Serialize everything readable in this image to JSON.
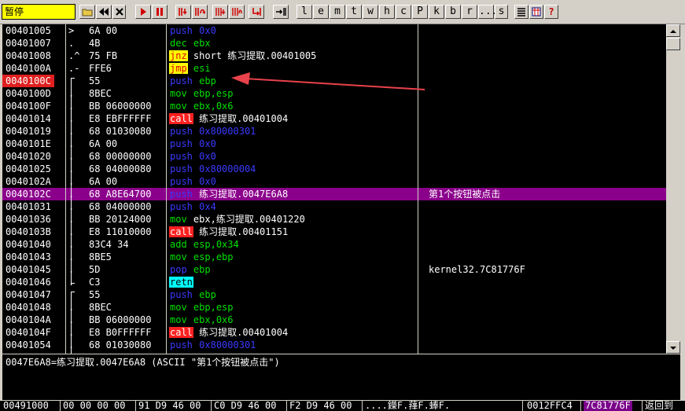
{
  "toolbar": {
    "status": "暂停",
    "letters": [
      "l",
      "e",
      "m",
      "t",
      "w",
      "h",
      "c",
      "P",
      "k",
      "b",
      "r",
      "...",
      "s"
    ]
  },
  "icons": [
    "open-icon",
    "rewind-icon",
    "close-icon",
    "run-icon",
    "pause-icon",
    "step-into-icon",
    "step-over-icon",
    "trace-into-icon",
    "trace-over-icon",
    "execute-till-return-icon",
    "goto-icon",
    "list-icon",
    "grid-icon",
    "help-icon"
  ],
  "colors": {
    "status_bg": "#ffff00",
    "selected_row": "#8b008b",
    "breakpoint": "#e02020",
    "push": "#3a3aff",
    "mov": "#00e000",
    "call_bg": "#ff2020",
    "jmp_bg": "#ffff00",
    "retn_bg": "#00ffff",
    "arrow": "#e8424a"
  },
  "rows": [
    {
      "addr": "00401005",
      "mark": ">",
      "hex": "6A 00",
      "kw": "push",
      "kc": "k-push",
      "op": "0x0",
      "oc": "op-blue",
      "cmt": ""
    },
    {
      "addr": "00401007",
      "mark": ".",
      "hex": "4B",
      "kw": "dec",
      "kc": "k-dec",
      "op": "ebx",
      "oc": "op-green",
      "cmt": ""
    },
    {
      "addr": "00401008",
      "mark": ".^",
      "hex": "75 FB",
      "kw": "jnz",
      "kc": "k-jnz",
      "op": "short 练习提取.00401005",
      "oc": "op-white",
      "cmt": ""
    },
    {
      "addr": "0040100A",
      "mark": ".-",
      "hex": "FFE6",
      "kw": "jmp",
      "kc": "k-jmp",
      "op": "esi",
      "oc": "op-green",
      "cmt": ""
    },
    {
      "addr": "0040100C",
      "mark": "",
      "hex": "55",
      "kw": "push",
      "kc": "k-push",
      "op": "ebp",
      "oc": "op-green",
      "cmt": "",
      "bp": true
    },
    {
      "addr": "0040100D",
      "mark": ".",
      "hex": "8BEC",
      "kw": "mov",
      "kc": "k-mov",
      "op": "ebp,esp",
      "oc": "op-green",
      "cmt": ""
    },
    {
      "addr": "0040100F",
      "mark": ".",
      "hex": "BB 06000000",
      "kw": "mov",
      "kc": "k-mov",
      "op": "ebx,0x6",
      "oc": "op-green",
      "cmt": ""
    },
    {
      "addr": "00401014",
      "mark": ".",
      "hex": "E8 EBFFFFFF",
      "kw": "call",
      "kc": "k-call",
      "op": "练习提取.00401004",
      "oc": "op-white",
      "cmt": ""
    },
    {
      "addr": "00401019",
      "mark": ".",
      "hex": "68 01030080",
      "kw": "push",
      "kc": "k-push",
      "op": "0x80000301",
      "oc": "op-blue",
      "cmt": ""
    },
    {
      "addr": "0040101E",
      "mark": ".",
      "hex": "6A 00",
      "kw": "push",
      "kc": "k-push",
      "op": "0x0",
      "oc": "op-blue",
      "cmt": ""
    },
    {
      "addr": "00401020",
      "mark": ".",
      "hex": "68 00000000",
      "kw": "push",
      "kc": "k-push",
      "op": "0x0",
      "oc": "op-blue",
      "cmt": ""
    },
    {
      "addr": "00401025",
      "mark": ".",
      "hex": "68 04000080",
      "kw": "push",
      "kc": "k-push",
      "op": "0x80000004",
      "oc": "op-blue",
      "cmt": ""
    },
    {
      "addr": "0040102A",
      "mark": ".",
      "hex": "6A 00",
      "kw": "push",
      "kc": "k-push",
      "op": "0x0",
      "oc": "op-blue",
      "cmt": ""
    },
    {
      "addr": "0040102C",
      "mark": ".",
      "hex": "68 A8E64700",
      "kw": "push",
      "kc": "k-push",
      "op": "练习提取.0047E6A8",
      "oc": "op-white",
      "cmt": "第1个按钮被点击",
      "sel": true
    },
    {
      "addr": "00401031",
      "mark": ".",
      "hex": "68 04000000",
      "kw": "push",
      "kc": "k-push",
      "op": "0x4",
      "oc": "op-blue",
      "cmt": ""
    },
    {
      "addr": "00401036",
      "mark": ".",
      "hex": "BB 20124000",
      "kw": "mov",
      "kc": "k-mov",
      "op": "ebx,练习提取.00401220",
      "oc": "op-white",
      "cmt": ""
    },
    {
      "addr": "0040103B",
      "mark": ".",
      "hex": "E8 11010000",
      "kw": "call",
      "kc": "k-call",
      "op": "练习提取.00401151",
      "oc": "op-white",
      "cmt": ""
    },
    {
      "addr": "00401040",
      "mark": ".",
      "hex": "83C4 34",
      "kw": "add",
      "kc": "k-add",
      "op": "esp,0x34",
      "oc": "op-green",
      "cmt": ""
    },
    {
      "addr": "00401043",
      "mark": ".",
      "hex": "8BE5",
      "kw": "mov",
      "kc": "k-mov",
      "op": "esp,ebp",
      "oc": "op-green",
      "cmt": ""
    },
    {
      "addr": "00401045",
      "mark": ".",
      "hex": "5D",
      "kw": "pop",
      "kc": "k-pop",
      "op": "ebp",
      "oc": "op-green",
      "cmt": "kernel32.7C81776F"
    },
    {
      "addr": "00401046",
      "mark": ".",
      "hex": "C3",
      "kw": "retn",
      "kc": "k-retn",
      "op": "",
      "oc": "op-white",
      "cmt": ""
    },
    {
      "addr": "00401047",
      "mark": "",
      "hex": "55",
      "kw": "push",
      "kc": "k-push",
      "op": "ebp",
      "oc": "op-green",
      "cmt": ""
    },
    {
      "addr": "00401048",
      "mark": ".",
      "hex": "8BEC",
      "kw": "mov",
      "kc": "k-mov",
      "op": "ebp,esp",
      "oc": "op-green",
      "cmt": ""
    },
    {
      "addr": "0040104A",
      "mark": ".",
      "hex": "BB 06000000",
      "kw": "mov",
      "kc": "k-mov",
      "op": "ebx,0x6",
      "oc": "op-green",
      "cmt": ""
    },
    {
      "addr": "0040104F",
      "mark": ".",
      "hex": "E8 B0FFFFFF",
      "kw": "call",
      "kc": "k-call",
      "op": "练习提取.00401004",
      "oc": "op-white",
      "cmt": ""
    },
    {
      "addr": "00401054",
      "mark": ".",
      "hex": "68 01030080",
      "kw": "push",
      "kc": "k-push",
      "op": "0x80000301",
      "oc": "op-blue",
      "cmt": ""
    }
  ],
  "info_text": "0047E6A8=练习提取.0047E6A8 (ASCII \"第1个按钮被点击\")",
  "dump": {
    "addr": "00491000",
    "hex1": "00 00 00 00",
    "hex2": "91 D9 46 00",
    "hex3": "C0 D9 46 00",
    "hex4": "F2 D9 46 00",
    "ascii": "....鑅F.萚F.蜯F.",
    "stack_addr": "0012FFC4",
    "stack_val": "7C81776F",
    "stack_cmt": "返回到"
  }
}
